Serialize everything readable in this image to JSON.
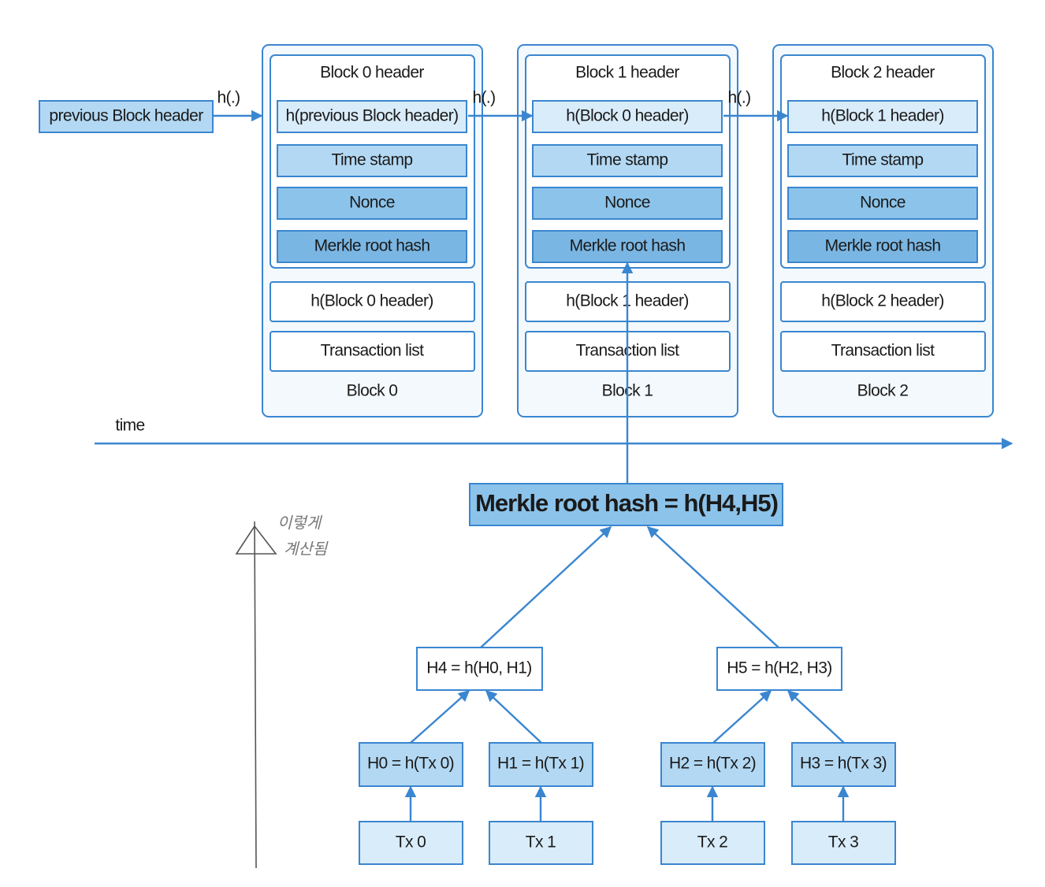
{
  "colors": {
    "border": "#3a86d0",
    "light": "#d9ecfa",
    "medium": "#b3d8f3",
    "dark": "#8cc3ea",
    "header_fill": "#ffffff"
  },
  "previous_block": "previous Block header",
  "hash_label": "h(.)",
  "blocks": [
    {
      "header_title": "Block 0 header",
      "prev_hash": "h(previous Block header)",
      "timestamp": "Time stamp",
      "nonce": "Nonce",
      "merkle": "Merkle root hash",
      "block_hash": "h(Block 0 header)",
      "tx_list": "Transaction list",
      "label": "Block 0"
    },
    {
      "header_title": "Block 1 header",
      "prev_hash": "h(Block 0 header)",
      "timestamp": "Time stamp",
      "nonce": "Nonce",
      "merkle": "Merkle root hash",
      "block_hash": "h(Block 1 header)",
      "tx_list": "Transaction list",
      "label": "Block 1"
    },
    {
      "header_title": "Block 2 header",
      "prev_hash": "h(Block 1 header)",
      "timestamp": "Time stamp",
      "nonce": "Nonce",
      "merkle": "Merkle root hash",
      "block_hash": "h(Block 2 header)",
      "tx_list": "Transaction list",
      "label": "Block 2"
    }
  ],
  "time_label": "time",
  "merkle_root": "Merkle root hash = h(H4,H5)",
  "level1": [
    "H4 = h(H0, H1)",
    "H5 = h(H2, H3)"
  ],
  "level0": [
    "H0 = h(Tx 0)",
    "H1 = h(Tx 1)",
    "H2 = h(Tx 2)",
    "H3 = h(Tx 3)"
  ],
  "transactions": [
    "Tx 0",
    "Tx 1",
    "Tx 2",
    "Tx 3"
  ],
  "handwritten_note": [
    "이렇게",
    "계산됨"
  ]
}
